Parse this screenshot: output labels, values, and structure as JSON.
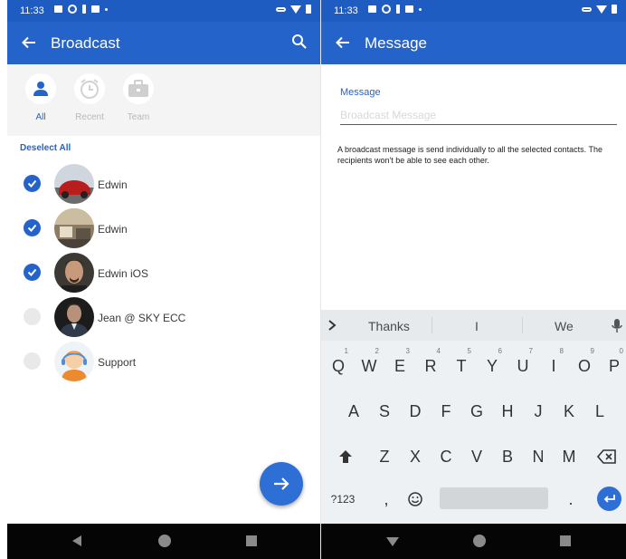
{
  "status_bar": {
    "time": "11:33"
  },
  "broadcast": {
    "title": "Broadcast",
    "tabs": [
      {
        "label": "All",
        "icon": "person-icon",
        "active": true
      },
      {
        "label": "Recent",
        "icon": "clock-icon",
        "active": false
      },
      {
        "label": "Team",
        "icon": "briefcase-icon",
        "active": false
      }
    ],
    "deselect_all": "Deselect All",
    "contacts": [
      {
        "name": "Edwin",
        "selected": true,
        "avatar": "car-photo"
      },
      {
        "name": "Edwin",
        "selected": true,
        "avatar": "room-photo"
      },
      {
        "name": "Edwin iOS",
        "selected": true,
        "avatar": "man-photo"
      },
      {
        "name": "Jean @ SKY ECC",
        "selected": false,
        "avatar": "suit-photo"
      },
      {
        "name": "Support",
        "selected": false,
        "avatar": "support-agent-illustration"
      }
    ],
    "next_button": "arrow-right-icon"
  },
  "message": {
    "title": "Message",
    "field_label": "Message",
    "placeholder": "Broadcast Message",
    "value": "",
    "help_text": "A broadcast message is send individually to all the selected contacts. The recipients won't be able to see each other."
  },
  "keyboard": {
    "suggestions": [
      "Thanks",
      "I",
      "We"
    ],
    "row1": [
      {
        "key": "Q",
        "hint": "1"
      },
      {
        "key": "W",
        "hint": "2"
      },
      {
        "key": "E",
        "hint": "3"
      },
      {
        "key": "R",
        "hint": "4"
      },
      {
        "key": "T",
        "hint": "5"
      },
      {
        "key": "Y",
        "hint": "6"
      },
      {
        "key": "U",
        "hint": "7"
      },
      {
        "key": "I",
        "hint": "8"
      },
      {
        "key": "O",
        "hint": "9"
      },
      {
        "key": "P",
        "hint": "0"
      }
    ],
    "row2": [
      "A",
      "S",
      "D",
      "F",
      "G",
      "H",
      "J",
      "K",
      "L"
    ],
    "row3": [
      "Z",
      "X",
      "C",
      "V",
      "B",
      "N",
      "M"
    ],
    "symbols_key": "?123",
    "comma_key": ",",
    "period_key": "."
  },
  "colors": {
    "app_bar": "#2463c9",
    "status_bar": "#1f5cc1",
    "accent": "#2e6fd6",
    "nav_bar": "#050505"
  }
}
